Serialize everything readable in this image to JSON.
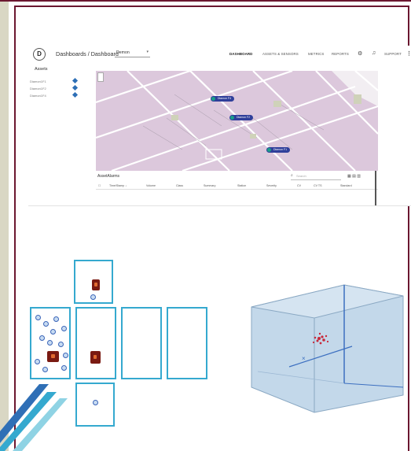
{
  "dashboard": {
    "logo_glyph": "D",
    "breadcrumb": "Dashboards / Dashboard",
    "selector_value": "Demon",
    "nav": [
      "DASHBOARD",
      "ASSETS & SENSORS",
      "METRICS",
      "REPORTS",
      "SUPPORT"
    ],
    "active_nav": "DASHBOARD",
    "assets_title": "Assets",
    "assets": [
      "Diamon1F1",
      "Diamon1F2",
      "Diamon1F4"
    ],
    "map_markers": [
      "Diamon F4",
      "Diamon F2",
      "Diamon F1"
    ],
    "alarms_title": "AssetAlarms",
    "search_placeholder": "Search",
    "columns": [
      "Time/Stamp ↓",
      "Volume",
      "Class",
      "Summary",
      "Station",
      "Severity",
      "CV",
      "CV TS",
      "Standard"
    ]
  },
  "colors": {
    "frame_border": "#6b1730",
    "map_fill": "#dcc8dc",
    "marker": "#2f3f9a",
    "diagram_outline": "#35a9cf",
    "box_fill": "#c3d8ea"
  },
  "icons": [
    "gear-icon",
    "bell-icon",
    "more-vertical-icon",
    "search-icon",
    "grid-icon"
  ]
}
